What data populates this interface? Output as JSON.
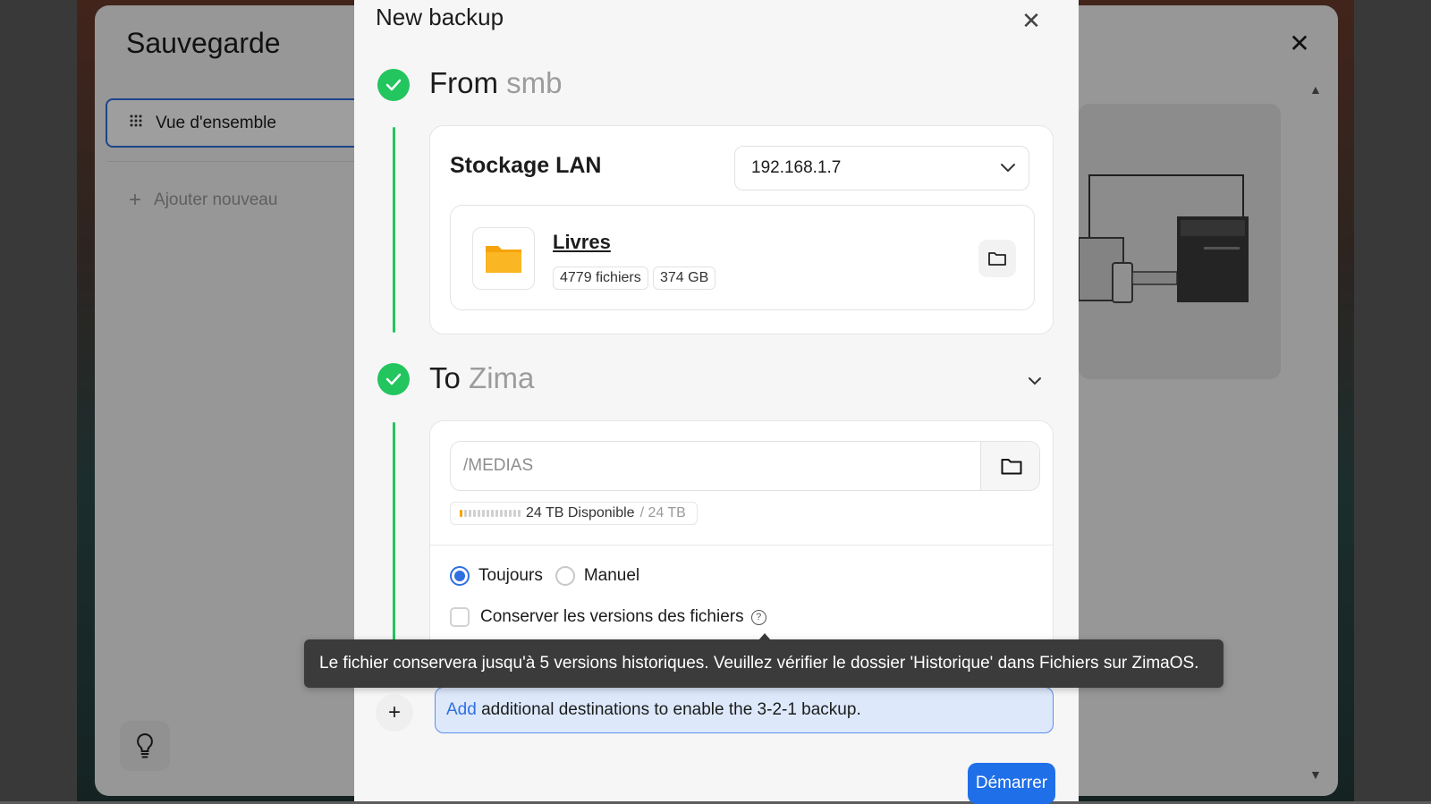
{
  "background": {
    "title": "Sauvegarde",
    "nav_overview": "Vue d'ensemble",
    "nav_add": "Ajouter nouveau"
  },
  "modal": {
    "title": "New backup",
    "from": {
      "prefix": "From",
      "source": "smb",
      "storage_label": "Stockage LAN",
      "selected_host": "192.168.1.7",
      "folder": {
        "name": "Livres",
        "file_count": "4779 fichiers",
        "size": "374 GB"
      }
    },
    "to": {
      "prefix": "To",
      "destination": "Zima",
      "path_placeholder": "/MEDIAS",
      "available": "24 TB Disponible",
      "total": "/ 24 TB",
      "schedule_options": [
        {
          "label": "Toujours",
          "selected": true
        },
        {
          "label": "Manuel",
          "selected": false
        }
      ],
      "keep_versions_label": "Conserver les versions des fichiers",
      "keep_versions_checked": false
    },
    "tooltip": "Le fichier conservera jusqu'à 5 versions historiques. Veuillez vérifier le dossier 'Historique' dans Fichiers sur ZimaOS.",
    "add_banner": {
      "link": "Add",
      "text": " additional destinations to enable the 3-2-1 backup."
    },
    "start_button": "Démarrer"
  },
  "colors": {
    "accent": "#2f6fe0",
    "success": "#22c55e",
    "folder": "#f5a30b",
    "tooltip_bg": "#3b3b3b"
  },
  "icons": {
    "check": "check-icon",
    "folder": "folder-icon",
    "chevron": "chevron-down-icon",
    "close": "close-icon",
    "help": "help-icon",
    "bulb": "lightbulb-icon",
    "grid": "grid-icon",
    "plus": "plus-icon"
  }
}
